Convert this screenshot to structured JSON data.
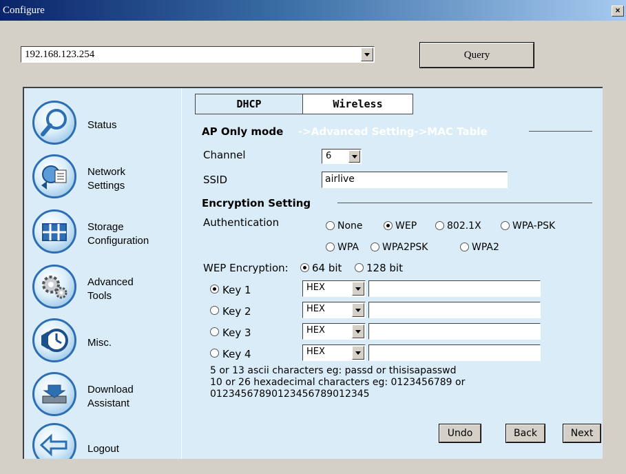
{
  "window": {
    "title": "Configure",
    "close_label": "×"
  },
  "device_select": {
    "value": "192.168.123.254"
  },
  "query_label": "Query",
  "sidebar": {
    "items": [
      {
        "label": "Status",
        "icon": "magnifier-icon"
      },
      {
        "label": "Network\nSettings",
        "icon": "network-icon"
      },
      {
        "label": "Storage\nConfiguration",
        "icon": "storage-icon"
      },
      {
        "label": "Advanced\nTools",
        "icon": "gears-icon"
      },
      {
        "label": "Misc.",
        "icon": "clock-icon"
      },
      {
        "label": "Download\nAssistant",
        "icon": "download-icon"
      },
      {
        "label": "Logout",
        "icon": "logout-icon"
      }
    ]
  },
  "tabs": [
    {
      "label": "DHCP"
    },
    {
      "label": "Wireless"
    }
  ],
  "mode": {
    "title": "AP Only mode",
    "links": "->Advanced Setting->MAC Table"
  },
  "channel": {
    "label": "Channel",
    "value": "6"
  },
  "ssid": {
    "label": "SSID",
    "value": "airlive"
  },
  "encryption": {
    "title": "Encryption Setting",
    "auth_label": "Authentication",
    "auth_options": [
      "None",
      "WEP",
      "802.1X",
      "WPA-PSK",
      "WPA",
      "WPA2PSK",
      "WPA2"
    ],
    "auth_selected": "WEP",
    "wep_label": "WEP Encryption:",
    "wep_options": [
      "64 bit",
      "128 bit"
    ],
    "wep_selected": "64 bit"
  },
  "keys": [
    {
      "label": "Key 1",
      "format": "HEX",
      "value": "",
      "selected": true
    },
    {
      "label": "Key 2",
      "format": "HEX",
      "value": "",
      "selected": false
    },
    {
      "label": "Key 3",
      "format": "HEX",
      "value": "",
      "selected": false
    },
    {
      "label": "Key 4",
      "format": "HEX",
      "value": "",
      "selected": false
    }
  ],
  "notes": {
    "line1": "5 or 13 ascii characters eg: passd or thisisapasswd",
    "line2": "10 or 26 hexadecimal characters eg: 0123456789 or",
    "line3": "01234567890123456789012345"
  },
  "buttons": {
    "undo": "Undo",
    "back": "Back",
    "next": "Next"
  }
}
